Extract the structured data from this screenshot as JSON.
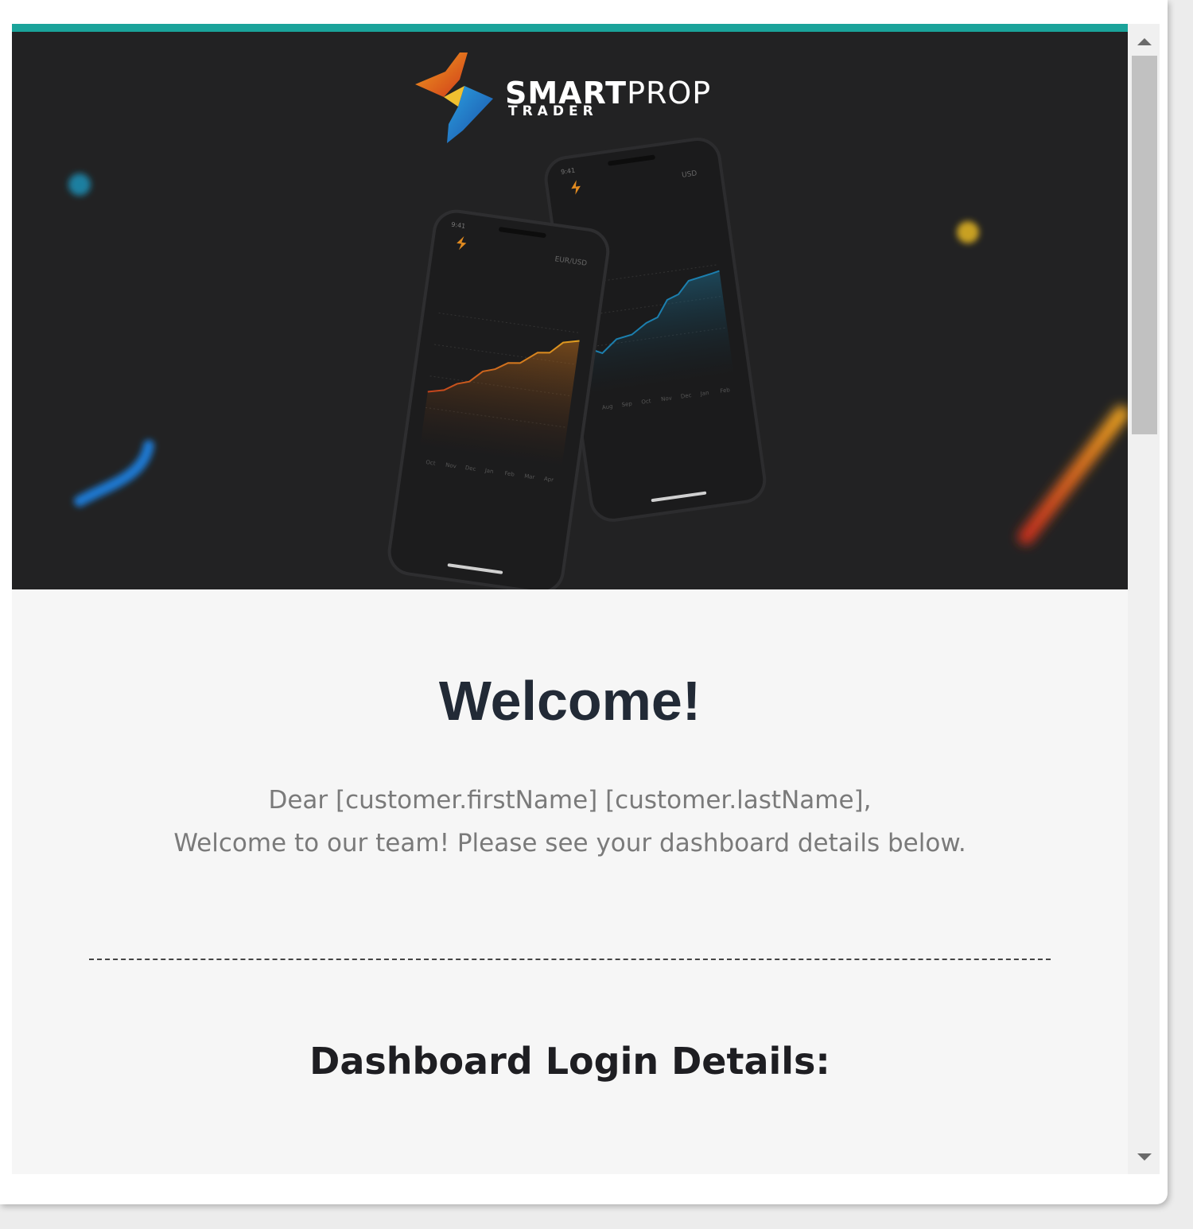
{
  "brand": {
    "name_bold": "SMART",
    "name_light": "PROP",
    "subtitle": "TRADER"
  },
  "phones": {
    "front": {
      "pair": "EUR/USD",
      "months": [
        "Oct",
        "Nov",
        "Dec",
        "Jan",
        "Feb",
        "Mar",
        "Apr"
      ]
    },
    "back": {
      "pair": "USD",
      "months": [
        "Aug",
        "Sep",
        "Oct",
        "Nov",
        "Dec",
        "Jan",
        "Feb"
      ]
    }
  },
  "email": {
    "heading": "Welcome!",
    "greeting_line1": "Dear [customer.firstName] [customer.lastName],",
    "greeting_line2": "Welcome to our team! Please see your dashboard details below.",
    "login_heading": "Dashboard Login Details:"
  },
  "colors": {
    "accent": "#1aa39a",
    "hero_bg": "#222223",
    "content_bg": "#f6f6f6",
    "heading": "#222a36",
    "body_text": "#7a7a7a"
  }
}
